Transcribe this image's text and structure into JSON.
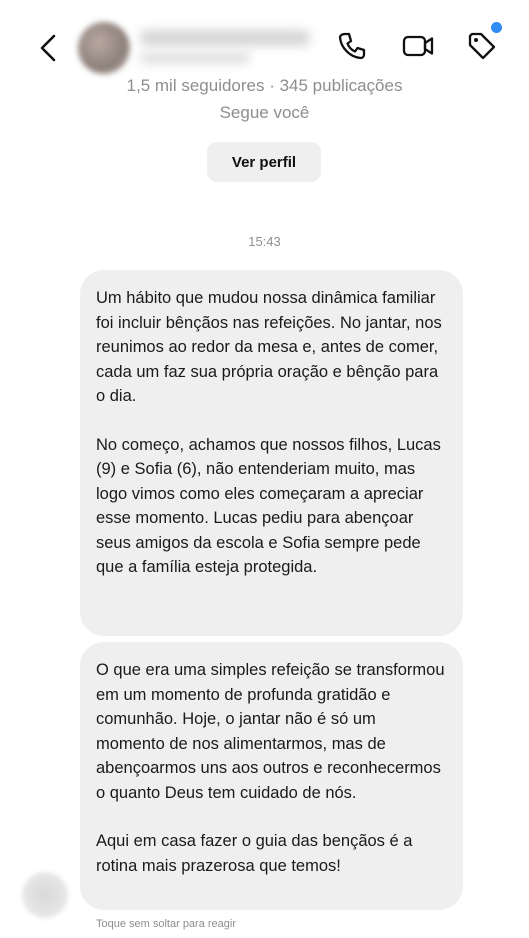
{
  "header": {
    "back_icon": "chevron-left-icon",
    "call_icon": "phone-icon",
    "video_icon": "video-camera-icon",
    "tag_icon": "tag-icon",
    "notification_color": "#2f8cf5"
  },
  "profile": {
    "stats": "1,5 mil seguidores · 345 publicações",
    "follows_you": "Segue você",
    "view_profile_label": "Ver perfil"
  },
  "chat": {
    "timestamp": "15:43",
    "messages": [
      {
        "paragraphs": [
          "Um hábito que mudou nossa dinâmica familiar foi incluir bênçãos nas refeições. No jantar, nos reunimos ao redor da mesa e, antes de comer, cada um faz sua própria oração e bênção para o dia.",
          "No começo, achamos que nossos filhos, Lucas (9) e Sofia (6), não entenderiam muito, mas logo vimos como eles começaram a apreciar esse momento. Lucas pediu para abençoar seus amigos da escola e Sofia sempre pede que a família esteja protegida."
        ]
      },
      {
        "paragraphs": [
          "O que era uma simples refeição se transformou em um momento de profunda gratidão e comunhão. Hoje, o jantar não é só um momento de nos alimentarmos, mas de abençoarmos uns aos outros e reconhecermos o quanto Deus tem cuidado de nós.",
          "Aqui em casa fazer o guia das bençãos é a rotina mais prazerosa que temos!"
        ]
      }
    ],
    "hint": "Toque sem soltar para reagir"
  }
}
